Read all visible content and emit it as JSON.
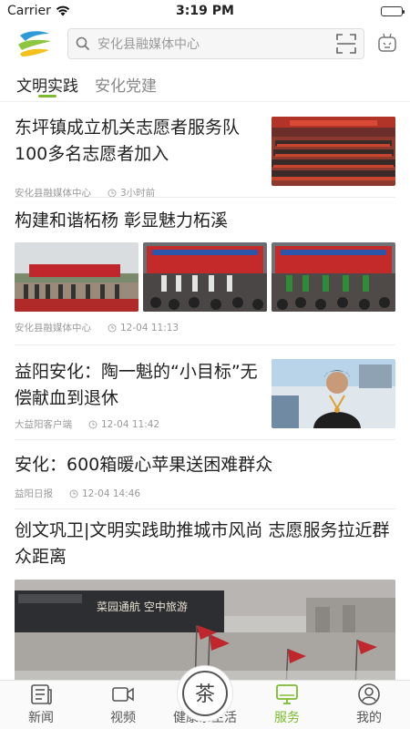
{
  "status_bar": {
    "carrier": "Carrier",
    "time": "3:19 PM"
  },
  "search": {
    "placeholder": "安化县融媒体中心"
  },
  "tabs": [
    {
      "label": "文明实践",
      "active": true
    },
    {
      "label": "安化党建",
      "active": false
    }
  ],
  "feed": [
    {
      "title": "东坪镇成立机关志愿者服务队100多名志愿者加入",
      "source": "安化县融媒体中心",
      "time": "3小时前"
    },
    {
      "title": "构建和谐柘杨 彰显魅力柘溪",
      "source": "安化县融媒体中心",
      "time": "12-04 11:13"
    },
    {
      "title": "益阳安化：陶一魁的“小目标”无偿献血到退休",
      "source": "大益阳客户端",
      "time": "12-04 11:42"
    },
    {
      "title": "安化：600箱暖心苹果送困难群众",
      "source": "益阳日报",
      "time": "12-04 14:46"
    },
    {
      "title": "创文巩卫|文明实践助推城市风尚 志愿服务拉近群众距离",
      "image_text": "菜园通航 空中旅游"
    }
  ],
  "tabbar": [
    {
      "label": "新闻",
      "icon": "news-icon"
    },
    {
      "label": "视频",
      "icon": "video-icon"
    },
    {
      "label": "健康茶生活",
      "icon": "tea-icon"
    },
    {
      "label": "服务",
      "icon": "service-icon",
      "active": true
    },
    {
      "label": "我的",
      "icon": "profile-icon"
    }
  ],
  "colors": {
    "accent": "#7cbb2f",
    "banner_red": "#c0272d"
  }
}
